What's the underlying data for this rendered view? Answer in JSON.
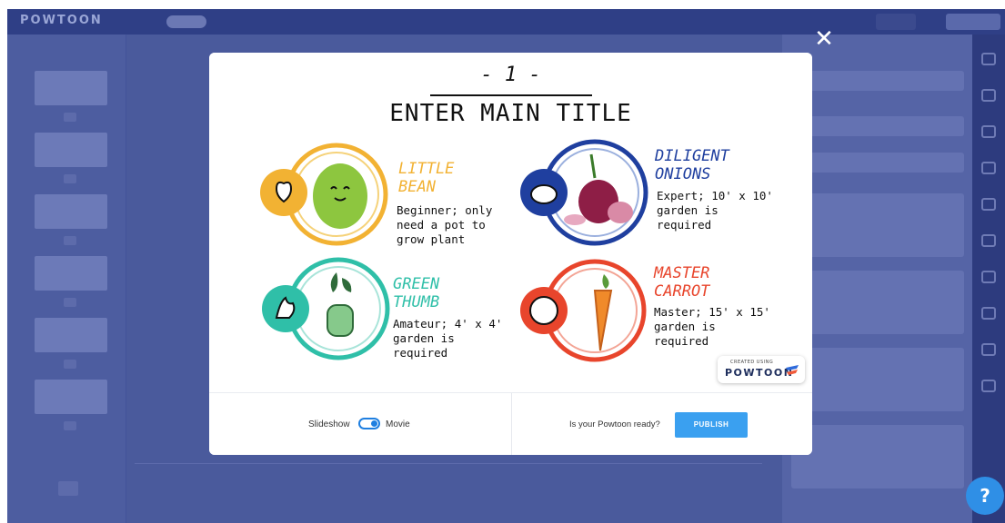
{
  "app": {
    "brand": "POWTOON",
    "accent_color": "#3aa0f0"
  },
  "modal": {
    "slide": {
      "number": "- 1 -",
      "title": "ENTER MAIN TITLE",
      "items": [
        {
          "title_line1": "LITTLE",
          "title_line2": "BEAN",
          "title_color": "#f2b233",
          "desc1": "Beginner; only",
          "desc2": "need a pot to",
          "desc3": "grow plant",
          "icon": "heart-icon",
          "ring_color": "#f2b233"
        },
        {
          "title_line1": "DILIGENT",
          "title_line2": "ONIONS",
          "title_color": "#1f3f9f",
          "desc1": "Expert; 10' x 10'",
          "desc2": "garden is",
          "desc3": "required",
          "icon": "piggy-bank-icon",
          "ring_color": "#1f3f9f"
        },
        {
          "title_line1": "GREEN",
          "title_line2": "THUMB",
          "title_color": "#2fbfa8",
          "desc1": "Amateur; 4' x 4'",
          "desc2": "garden is",
          "desc3": "required",
          "icon": "flame-icon",
          "ring_color": "#2fbfa8"
        },
        {
          "title_line1": "MASTER",
          "title_line2": "CARROT",
          "title_color": "#e8452c",
          "desc1": "Master; 15' x 15'",
          "desc2": "garden is",
          "desc3": "required",
          "icon": "handshake-icon",
          "ring_color": "#e8452c"
        }
      ],
      "badge_small": "CREATED USING",
      "badge_brand": "POWTOON"
    },
    "footer": {
      "slideshow_label": "Slideshow",
      "movie_label": "Movie",
      "ready_label": "Is your Powtoon ready?",
      "publish_label": "PUBLISH"
    }
  },
  "help": {
    "label": "?"
  },
  "close": {
    "label": "✕"
  }
}
